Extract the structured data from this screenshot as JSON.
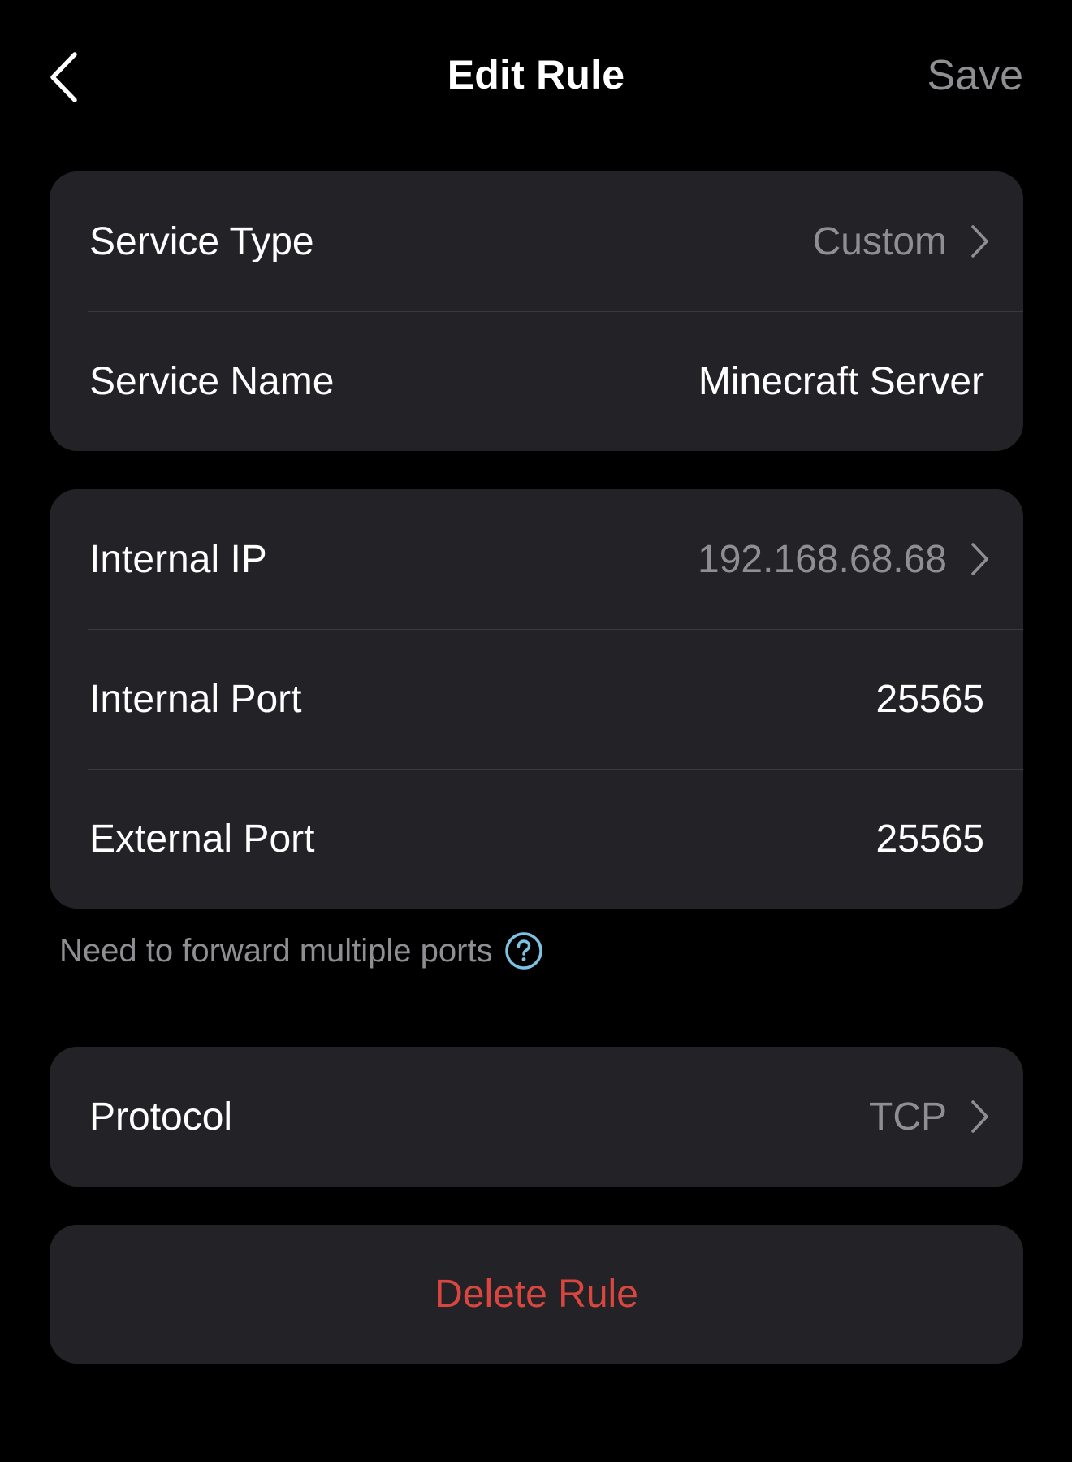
{
  "colors": {
    "background": "#000000",
    "card": "#232327",
    "secondary_text": "#8e8e93",
    "destructive": "#d9463f",
    "help_accent": "#7cc3e3"
  },
  "nav": {
    "back_icon": "chevron-left-icon",
    "title": "Edit Rule",
    "save_label": "Save"
  },
  "service_card": {
    "rows": [
      {
        "label": "Service Type",
        "value": "Custom",
        "icon": "chevron-right-icon"
      },
      {
        "label": "Service Name",
        "value": "Minecraft Server"
      }
    ]
  },
  "port_card": {
    "rows": [
      {
        "label": "Internal IP",
        "value": "192.168.68.68",
        "icon": "chevron-right-icon"
      },
      {
        "label": "Internal Port",
        "value": "25565"
      },
      {
        "label": "External Port",
        "value": "25565"
      }
    ]
  },
  "hint": {
    "text": "Need to forward multiple ports",
    "icon": "question-circle-icon"
  },
  "protocol_card": {
    "rows": [
      {
        "label": "Protocol",
        "value": "TCP",
        "icon": "chevron-right-icon"
      }
    ]
  },
  "delete": {
    "label": "Delete Rule"
  }
}
